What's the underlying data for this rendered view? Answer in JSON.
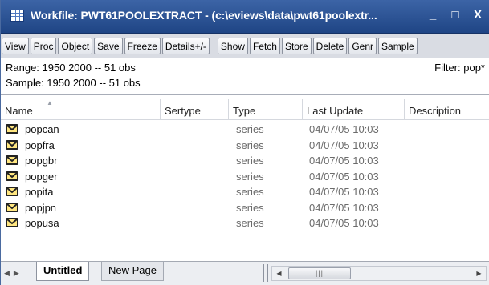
{
  "window": {
    "title": "Workfile: PWT61POOLEXTRACT - (c:\\eviews\\data\\pwt61poolextr...",
    "minimize": "_",
    "maximize": "□",
    "close": "X"
  },
  "toolbar": {
    "buttons": [
      "View",
      "Proc",
      "Object",
      "Save",
      "Freeze",
      "Details+/-",
      "Show",
      "Fetch",
      "Store",
      "Delete",
      "Genr",
      "Sample"
    ]
  },
  "info": {
    "range": "Range:  1950 2000  --  51 obs",
    "sample": "Sample: 1950 2000  --  51 obs",
    "filter": "Filter: pop*"
  },
  "columns": {
    "name": "Name",
    "sertype": "Sertype",
    "type": "Type",
    "last_update": "Last Update",
    "description": "Description"
  },
  "series": [
    {
      "name": "popcan",
      "type": "series",
      "last_update": "04/07/05  10:03"
    },
    {
      "name": "popfra",
      "type": "series",
      "last_update": "04/07/05  10:03"
    },
    {
      "name": "popgbr",
      "type": "series",
      "last_update": "04/07/05  10:03"
    },
    {
      "name": "popger",
      "type": "series",
      "last_update": "04/07/05  10:03"
    },
    {
      "name": "popita",
      "type": "series",
      "last_update": "04/07/05  10:03"
    },
    {
      "name": "popjpn",
      "type": "series",
      "last_update": "04/07/05  10:03"
    },
    {
      "name": "popusa",
      "type": "series",
      "last_update": "04/07/05  10:03"
    }
  ],
  "tabs": {
    "active": "Untitled",
    "inactive": "New Page"
  },
  "icons": {
    "window": "workfile-icon",
    "series": "series-icon"
  },
  "colors": {
    "titlebar": "#2a52a0",
    "series_icon_fill": "#ffe680",
    "muted_text": "#6b6b6b"
  }
}
